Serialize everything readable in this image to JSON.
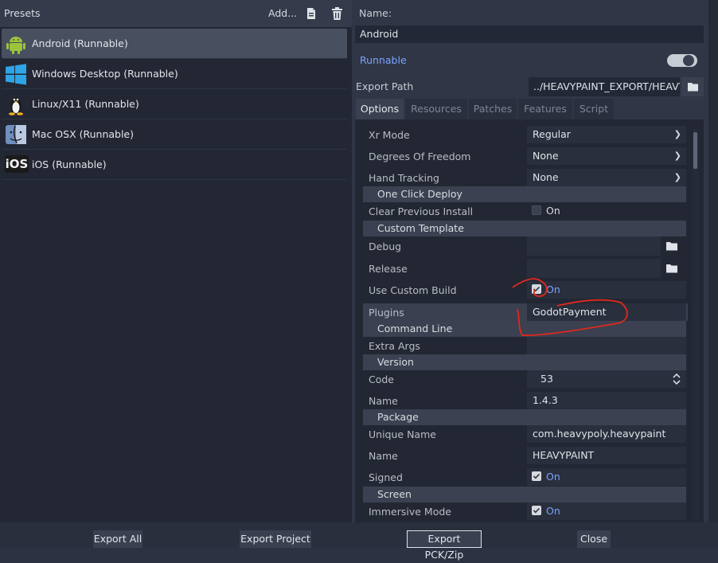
{
  "presets_panel": {
    "title": "Presets",
    "add_label": "Add...",
    "items": [
      {
        "label": "Android (Runnable)",
        "icon": "android-icon",
        "selected": true
      },
      {
        "label": "Windows Desktop (Runnable)",
        "icon": "windows-icon",
        "selected": false
      },
      {
        "label": "Linux/X11 (Runnable)",
        "icon": "linux-icon",
        "selected": false
      },
      {
        "label": "Mac OSX (Runnable)",
        "icon": "macos-icon",
        "selected": false
      },
      {
        "label": "iOS (Runnable)",
        "icon": "ios-icon",
        "icon_text": "iOS",
        "selected": false
      }
    ]
  },
  "preset_form": {
    "name_label": "Name:",
    "name_value": "Android",
    "runnable_label": "Runnable",
    "runnable_on": true,
    "export_path_label": "Export Path",
    "export_path_value": "../HEAVYPAINT_EXPORT/HEAVY"
  },
  "tabs": [
    {
      "label": "Options",
      "active": true
    },
    {
      "label": "Resources",
      "active": false
    },
    {
      "label": "Patches",
      "active": false
    },
    {
      "label": "Features",
      "active": false
    },
    {
      "label": "Script",
      "active": false
    }
  ],
  "options": {
    "xr_mode": {
      "label": "Xr Mode",
      "value": "Regular"
    },
    "dof": {
      "label": "Degrees Of Freedom",
      "value": "None"
    },
    "hand_tracking": {
      "label": "Hand Tracking",
      "value": "None"
    },
    "section_one_click": "One Click Deploy",
    "clear_install": {
      "label": "Clear Previous Install",
      "value": "On",
      "checked": false
    },
    "section_custom_template": "Custom Template",
    "debug": {
      "label": "Debug",
      "value": ""
    },
    "release": {
      "label": "Release",
      "value": ""
    },
    "use_custom_build": {
      "label": "Use Custom Build",
      "value": "On",
      "checked": true
    },
    "plugins": {
      "label": "Plugins",
      "value": "GodotPayment"
    },
    "section_command_line": "Command Line",
    "extra_args": {
      "label": "Extra Args",
      "value": ""
    },
    "section_version": "Version",
    "code": {
      "label": "Code",
      "value": "53"
    },
    "version_name": {
      "label": "Name",
      "value": "1.4.3"
    },
    "section_package": "Package",
    "unique_name": {
      "label": "Unique Name",
      "value": "com.heavypoly.heavypaint"
    },
    "package_name": {
      "label": "Name",
      "value": "HEAVYPAINT"
    },
    "signed": {
      "label": "Signed",
      "value": "On",
      "checked": true
    },
    "section_screen": "Screen",
    "immersive": {
      "label": "Immersive Mode",
      "value": "On",
      "checked": true
    }
  },
  "footer": {
    "export_all": "Export All",
    "export_project": "Export Project",
    "export_pck": "Export PCK/Zip",
    "close": "Close"
  },
  "colors": {
    "accent_blue": "#7aa3ff",
    "annotation_red": "#e0281e"
  }
}
